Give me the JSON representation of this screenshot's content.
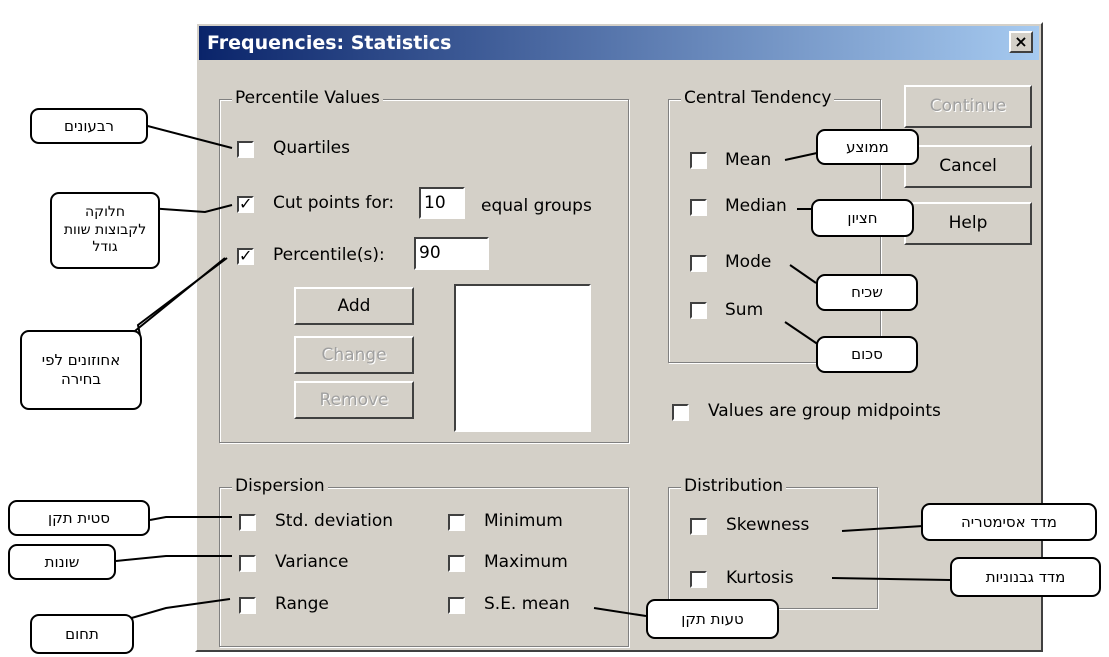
{
  "dialog": {
    "title": "Frequencies: Statistics",
    "close_glyph": "×"
  },
  "percentile_values": {
    "group_label": "Percentile Values",
    "quartiles": {
      "label": "Quartiles",
      "checked": false
    },
    "cut_points": {
      "label": "Cut points for:",
      "value": "10",
      "suffix": "equal groups",
      "checked": true
    },
    "percentiles": {
      "label": "Percentile(s):",
      "value": "90",
      "checked": true
    },
    "buttons": {
      "add": "Add",
      "change": "Change",
      "remove": "Remove"
    }
  },
  "central_tendency": {
    "group_label": "Central Tendency",
    "mean": "Mean",
    "median": "Median",
    "mode": "Mode",
    "sum": "Sum"
  },
  "side_buttons": {
    "continue": "Continue",
    "cancel": "Cancel",
    "help": "Help"
  },
  "midpoints": {
    "label": "Values are group midpoints"
  },
  "dispersion": {
    "group_label": "Dispersion",
    "std_deviation": "Std. deviation",
    "variance": "Variance",
    "range": "Range",
    "minimum": "Minimum",
    "maximum": "Maximum",
    "se_mean": "S.E. mean"
  },
  "distribution": {
    "group_label": "Distribution",
    "skewness": "Skewness",
    "kurtosis": "Kurtosis"
  },
  "callouts": {
    "quartiles": "רבעונים",
    "cut_points": "חלוקה לקבוצות שוות גודל",
    "percentiles": "אחוזונים לפי בחירה",
    "mean": "ממוצע",
    "median": "חציון",
    "mode": "שכיח",
    "sum": "סכום",
    "std_deviation": "סטית תקן",
    "variance": "שונות",
    "range": "תחום",
    "se_mean": "טעות תקן",
    "skewness": "מדד אסימטריה",
    "kurtosis": "מדד גבנוניות"
  },
  "check_glyph": "✓"
}
